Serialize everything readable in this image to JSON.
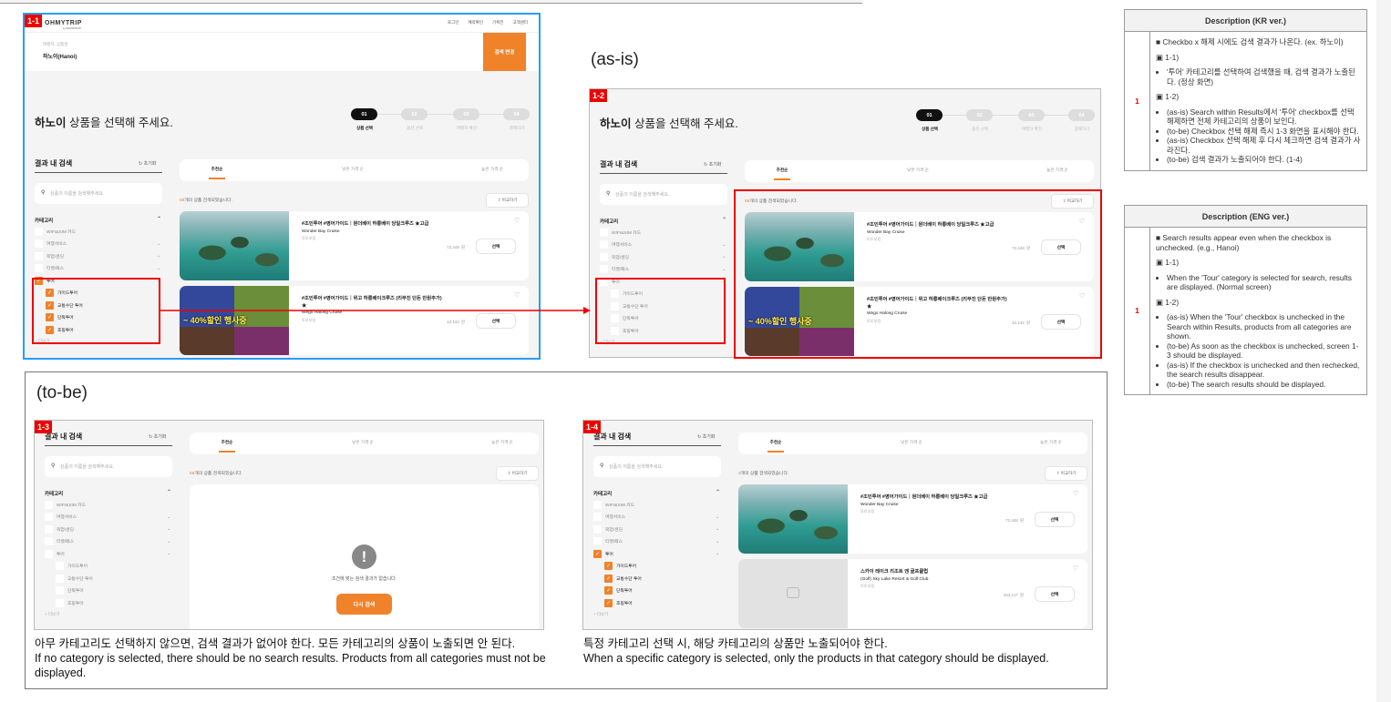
{
  "shop": {
    "logo": "OHMYTRIP",
    "logo_sub": "by ONLINETOUR",
    "nav": [
      "로그인",
      "예약확인",
      "기획전",
      "고객센터"
    ],
    "search_label": "여행지, 상품명",
    "search_value": "하노이(Hanoi)",
    "search_button": "검색 변경",
    "title_bold": "하노이",
    "title_rest": " 상품을 선택해 주세요.",
    "steps": [
      {
        "num": "01",
        "label": "상품 선택"
      },
      {
        "num": "02",
        "label": "옵션 선택"
      },
      {
        "num": "03",
        "label": "여행자 확인"
      },
      {
        "num": "04",
        "label": "결제하기"
      }
    ],
    "sidebar_title": "결과 내 검색",
    "reset": "초기화",
    "search_placeholder": "상품의 이름을 검색해주세요.",
    "category_title": "카테고리",
    "categories": [
      {
        "label": "WIFI&SIM 카드",
        "expandable": false
      },
      {
        "label": "여행서비스",
        "expandable": true
      },
      {
        "label": "픽업/샌딩",
        "expandable": true
      },
      {
        "label": "티켓/패스",
        "expandable": true
      },
      {
        "label": "투어",
        "expandable": true
      }
    ],
    "tour_subs": [
      "가이드투어",
      "교통수단 투어",
      "단독투어",
      "호핑투어"
    ],
    "more": "더보기",
    "sort_tabs": [
      "추천순",
      "낮은 가격 순",
      "높은 가격 순"
    ],
    "count_suffix": "개의 상품 검색되었습니다.",
    "compare": "비교하기",
    "currency": "원",
    "select": "선택",
    "empty_text": "조건에 맞는 검색 결과가 없습니다.",
    "retry": "다시 검색",
    "accent": "#f0822a"
  },
  "products": [
    {
      "tags": "#조인투어 #영어가이드｜원더베이 하롱베이 당일크루즈 ★고급",
      "name": "Wonder Bay Cruise",
      "supplier": "토토부킹",
      "price": "72,448",
      "image": "halong-bay-photo"
    },
    {
      "tags": "#조인투어 #영어가이드｜위고 하롱베이크루즈 (리무진 단돈 만원추가) ★",
      "name": "Wego Halong Cruise",
      "supplier": "토토부킹",
      "price": "42,142",
      "image": "cruise-collage",
      "banner": "~ 40%할인 행사중"
    },
    {
      "tags": "스카이 레이크 리조트 앤 골프클럽",
      "name": "(Golf) Sky Lake Resort & Golf Club",
      "supplier": "토토부킹",
      "price": "254,117",
      "image": "placeholder"
    }
  ],
  "panels": [
    {
      "label": "1-1",
      "count": "58",
      "tour_checked": true,
      "products": [
        0,
        1
      ],
      "empty": false,
      "show_header": true
    },
    {
      "label": "1-2",
      "count": "58",
      "tour_checked": false,
      "products": [
        0,
        1
      ],
      "empty": false,
      "show_header": false
    },
    {
      "label": "1-3",
      "count": "58",
      "tour_checked": false,
      "products": [],
      "empty": true,
      "show_header": false
    },
    {
      "label": "1-4",
      "count": "3",
      "tour_checked": true,
      "products": [
        0,
        2
      ],
      "empty": false,
      "show_header": false
    }
  ],
  "labels": {
    "as_is": "(as-is)",
    "to_be": "(to-be)"
  },
  "captions": {
    "c13_kr": "아무 카테고리도 선택하지 않으면, 검색 결과가 없어야 한다. 모든 카테고리의 상품이 노출되면 안 된다.",
    "c13_en": "If no category is selected, there should be no search results. Products from all categories must not be displayed.",
    "c14_kr": "특정 카테고리 선택 시, 해당 카테고리의 상품만 노출되어야 한다.",
    "c14_en": "When a specific category is selected, only the products in that category should be displayed."
  },
  "desc_kr": {
    "header": "Description (KR ver.)",
    "no": "1",
    "summary": "■ Checkbo x 해제 시에도 검색 결과가 나온다. (ex. 하노이)",
    "s1": "▣ 1-1)",
    "s1_items": [
      "'투어' 카테고리를 선택하여 검색했을 때, 검색 결과가 노출된다. (정상 화면)"
    ],
    "s2": "▣ 1-2)",
    "s2_items": [
      "(as-is) Search within Results에서 '투어' checkbox를 선택 해제하면 전체 카테고리의 상품이 보인다.",
      "(to-be) Checkbox 선택 해제 즉시 1-3 화면을 표시해야 한다.",
      "(as-is) Checkbox 선택 해제 후 다시 체크하면 검색 결과가 사라진다.",
      "(to-be) 검색 결과가 노출되어야 한다. (1-4)"
    ]
  },
  "desc_en": {
    "header": "Description (ENG ver.)",
    "no": "1",
    "summary": "■ Search results appear even when the checkbox is unchecked. (e.g., Hanoi)",
    "s1": "▣ 1-1)",
    "s1_items": [
      "When the 'Tour' category is selected for search, results are displayed. (Normal screen)"
    ],
    "s2": "▣ 1-2)",
    "s2_items": [
      "(as-is) When the 'Tour' checkbox is unchecked in the Search within Results, products from all categories are shown.",
      "(to-be) As soon as the checkbox is unchecked, screen 1-3 should be displayed.",
      "(as-is) If the checkbox is unchecked and then rechecked, the search results disappear.",
      "(to-be) The search results should be displayed."
    ]
  }
}
